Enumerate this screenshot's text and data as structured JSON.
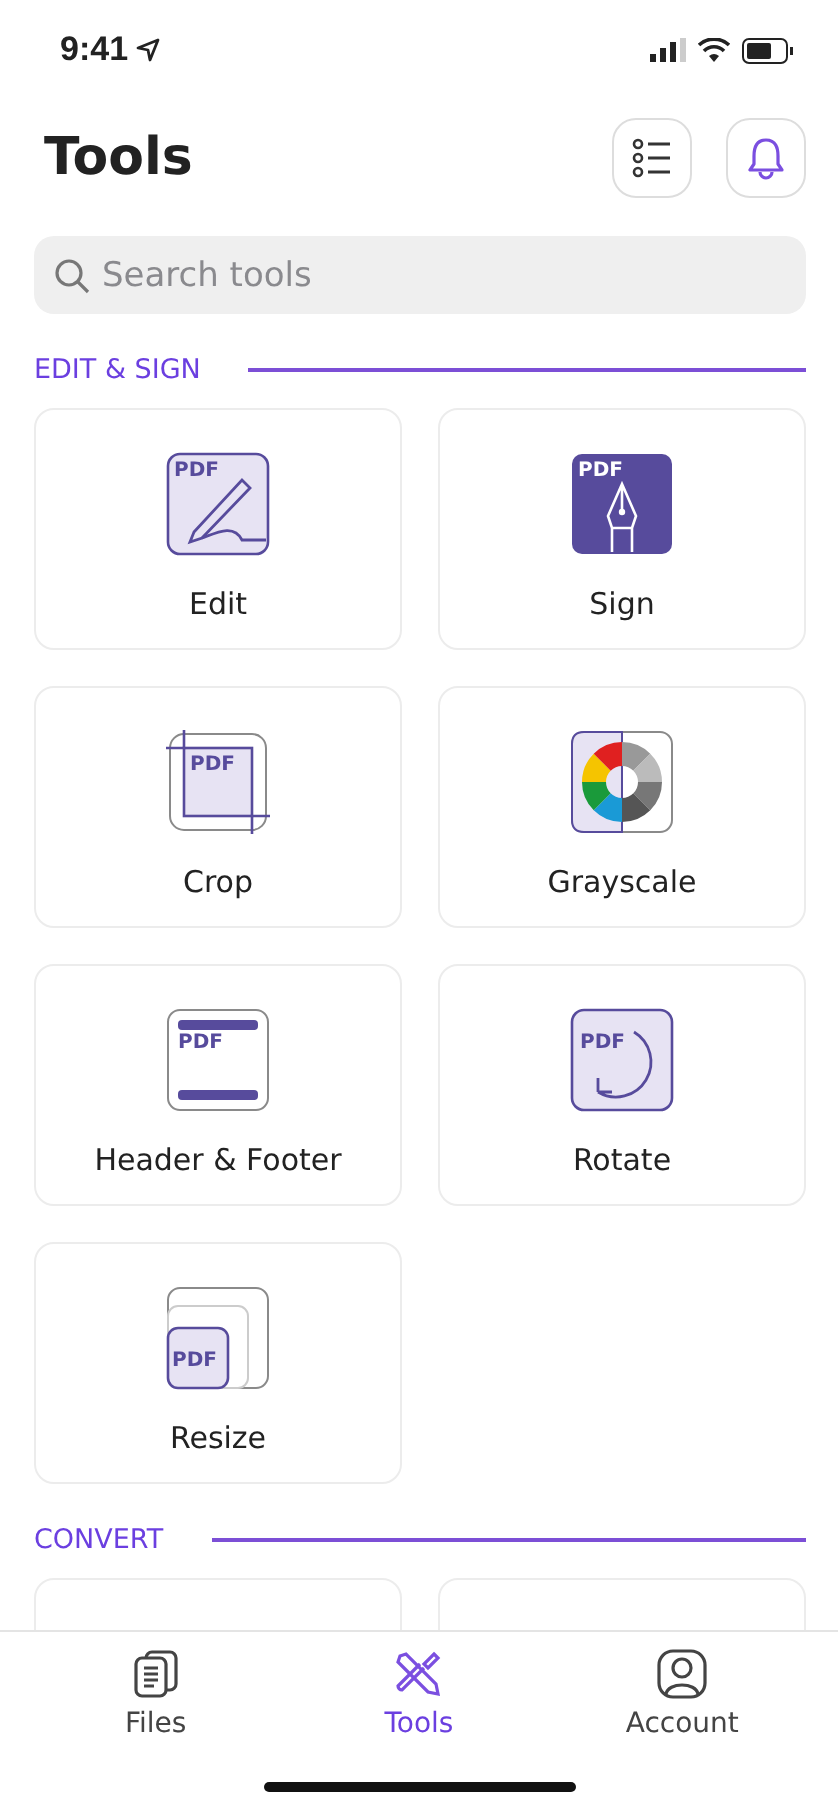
{
  "status_bar": {
    "time": "9:41"
  },
  "header": {
    "title": "Tools"
  },
  "search": {
    "placeholder": "Search tools"
  },
  "sections": [
    {
      "title": "EDIT & SIGN",
      "tools": [
        {
          "label": "Edit",
          "kind": "edit",
          "badge": "PDF"
        },
        {
          "label": "Sign",
          "kind": "sign",
          "badge": "PDF"
        },
        {
          "label": "Crop",
          "kind": "crop",
          "badge": "PDF"
        },
        {
          "label": "Grayscale",
          "kind": "grayscale"
        },
        {
          "label": "Header & Footer",
          "kind": "header-footer",
          "badge": "PDF"
        },
        {
          "label": "Rotate",
          "kind": "rotate",
          "badge": "PDF"
        },
        {
          "label": "Resize",
          "kind": "resize",
          "badge": "PDF"
        }
      ]
    },
    {
      "title": "CONVERT"
    }
  ],
  "tab_bar": [
    {
      "label": "Files",
      "kind": "files",
      "selected": false
    },
    {
      "label": "Tools",
      "kind": "tools",
      "selected": true
    },
    {
      "label": "Account",
      "kind": "account",
      "selected": false
    }
  ]
}
